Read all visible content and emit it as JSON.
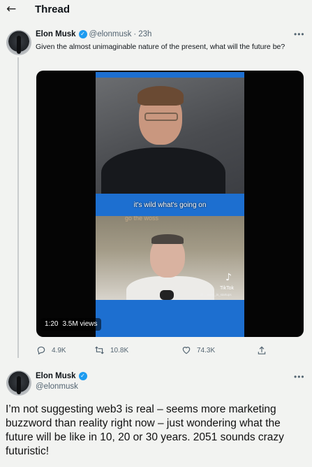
{
  "header": {
    "title": "Thread"
  },
  "tweet1": {
    "author_name": "Elon Musk",
    "handle": "@elonmusk",
    "separator": "·",
    "time": "23h",
    "text": "Given the almost unimaginable nature of the present, what will the future be?",
    "video": {
      "caption": "it's wild what's going on",
      "faded_caption": "go the woss",
      "tiktok_label": "TikTok",
      "tiktok_handle": "@__week_in_startups",
      "duration": "1:20",
      "views": "3.5M views"
    },
    "actions": {
      "replies": "4.9K",
      "retweets": "10.8K",
      "likes": "74.3K"
    }
  },
  "tweet2": {
    "author_name": "Elon Musk",
    "handle": "@elonmusk",
    "text": "I’m not suggesting web3 is real – seems more marketing buzzword than reality right now – just wondering what the future will be like in 10, 20 or 30 years. 2051 sounds crazy futuristic!"
  },
  "icons": {
    "back": "back-arrow-icon",
    "verified": "verified-badge-icon",
    "more": "more-options-icon",
    "reply": "reply-icon",
    "retweet": "retweet-icon",
    "like": "like-icon",
    "share": "share-icon",
    "tiktok": "tiktok-logo-icon"
  },
  "colors": {
    "verified": "#1d9bf0",
    "background": "#f2f3f1",
    "muted_text": "#536471"
  }
}
